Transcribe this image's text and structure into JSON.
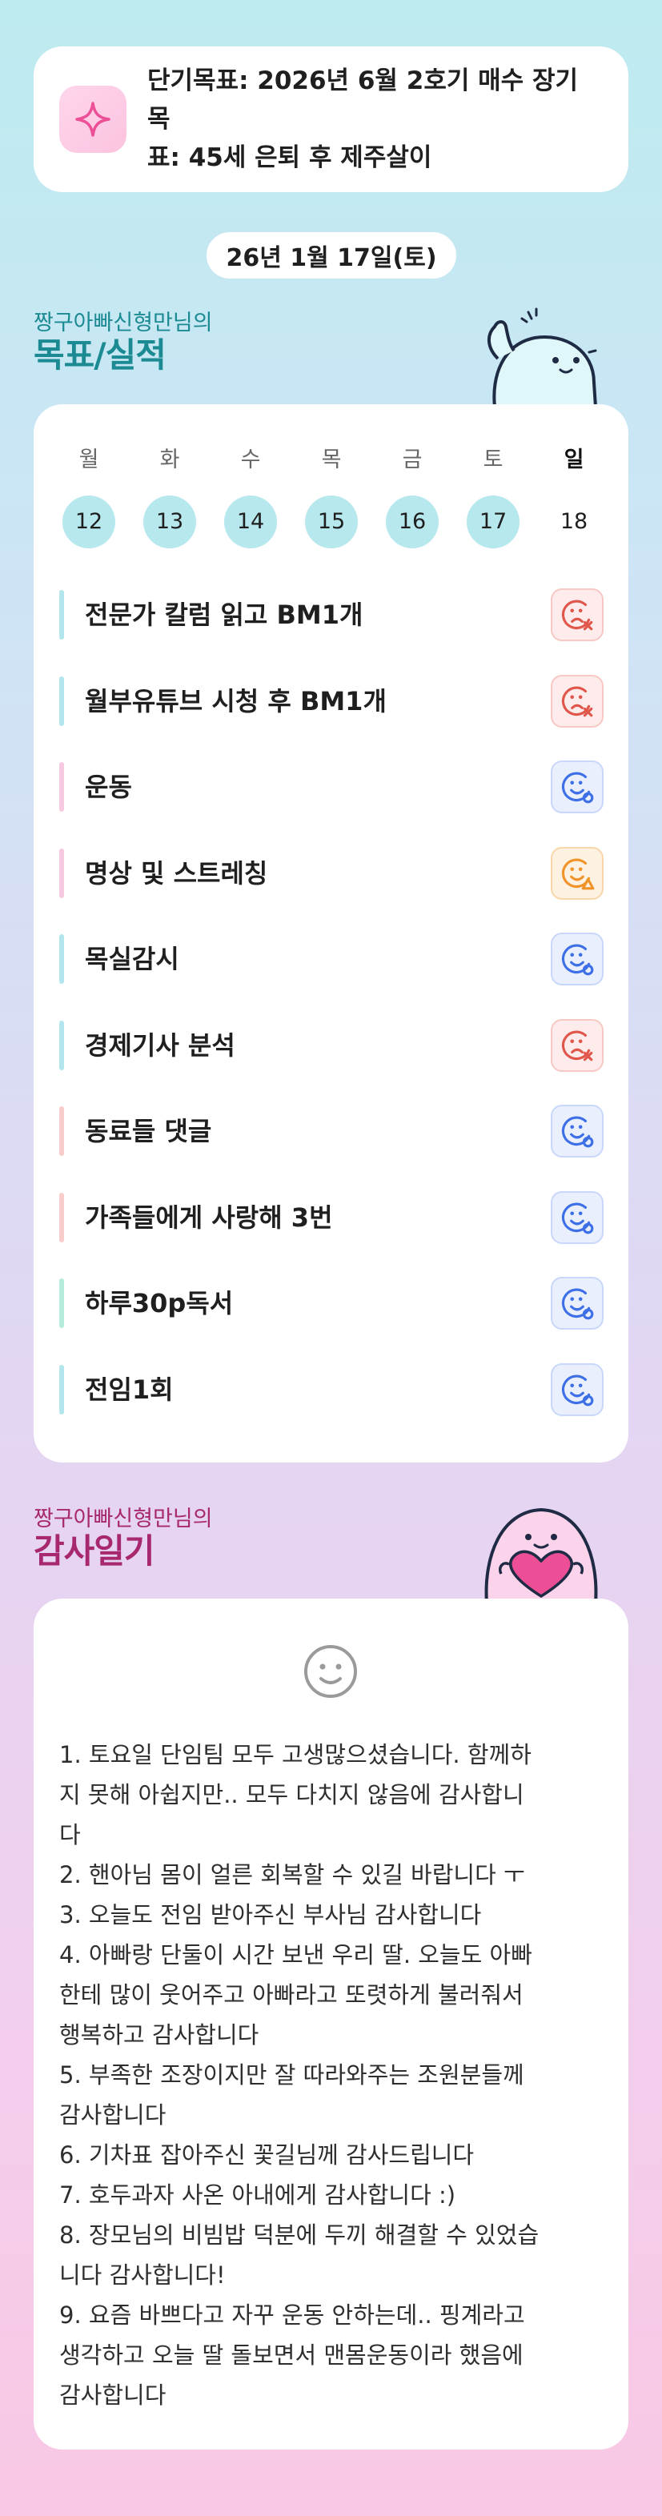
{
  "goal": {
    "text_line1": "단기목표: 2026년 6월 2호기 매수 장기목",
    "text_line2": "표: 45세 은퇴 후 제주살이",
    "icon": "sparkle-icon"
  },
  "date": "26년 1월 17일(토)",
  "record_section": {
    "subtitle": "짱구아빠신형만님의",
    "title": "목표/실적"
  },
  "week": {
    "days": [
      {
        "name": "월",
        "num": "12",
        "done": true
      },
      {
        "name": "화",
        "num": "13",
        "done": true
      },
      {
        "name": "수",
        "num": "14",
        "done": true
      },
      {
        "name": "목",
        "num": "15",
        "done": true
      },
      {
        "name": "금",
        "num": "16",
        "done": true
      },
      {
        "name": "토",
        "num": "17",
        "done": true
      },
      {
        "name": "일",
        "num": "18",
        "done": false
      }
    ]
  },
  "tasks": [
    {
      "label": "전문가 칼럼 읽고 BM1개",
      "status": "fail",
      "bar_color": "#b3e6ec"
    },
    {
      "label": "월부유튜브 시청 후 BM1개",
      "status": "fail",
      "bar_color": "#b3e6ec"
    },
    {
      "label": "운동",
      "status": "success",
      "bar_color": "#f6c9e1"
    },
    {
      "label": "명상 및 스트레칭",
      "status": "partial",
      "bar_color": "#f6c9e1"
    },
    {
      "label": "목실감시",
      "status": "success",
      "bar_color": "#b3e6ec"
    },
    {
      "label": "경제기사 분석",
      "status": "fail",
      "bar_color": "#b3e6ec"
    },
    {
      "label": "동료들 댓글",
      "status": "success",
      "bar_color": "#f8cccb"
    },
    {
      "label": "가족들에게 사랑해 3번",
      "status": "success",
      "bar_color": "#f8cccb"
    },
    {
      "label": "하루30p독서",
      "status": "success",
      "bar_color": "#b5ecdc"
    },
    {
      "label": "전임1회",
      "status": "success",
      "bar_color": "#b3e6ec"
    }
  ],
  "status_colors": {
    "fail": {
      "bg": "#fdeceb",
      "border": "#f7c8c4",
      "fg": "#e0564a"
    },
    "success": {
      "bg": "#e9effd",
      "border": "#c9d7fa",
      "fg": "#3d6fe6"
    },
    "partial": {
      "bg": "#fdf1e2",
      "border": "#f8d6aa",
      "fg": "#f0942a"
    }
  },
  "diary_section": {
    "subtitle": "짱구아빠신형만님의",
    "title": "감사일기"
  },
  "diary": {
    "icon": "smile-icon",
    "lines": [
      "1. 토요일 단임팀 모두 고생많으셨습니다. 함께하",
      "지 못해 아쉽지만.. 모두 다치지 않음에 감사합니",
      "다",
      "2. 핸아님 몸이 얼른 회복할 수 있길 바랍니다 ㅜ",
      "3. 오늘도 전임 받아주신 부사님 감사합니다",
      "4. 아빠랑 단둘이 시간 보낸 우리 딸. 오늘도 아빠",
      "한테 많이 웃어주고 아빠라고 또렷하게 불러줘서",
      "행복하고 감사합니다",
      "5. 부족한 조장이지만 잘 따라와주는 조원분들께",
      "감사합니다",
      "6. 기차표 잡아주신 꽃길님께 감사드립니다",
      "7. 호두과자 사온 아내에게 감사합니다 :)",
      "8. 장모님의 비빔밥 덕분에 두끼 해결할 수 있었습",
      "니다 감사합니다!",
      "9. 요즘 바쁘다고 자꾸 운동 안하는데.. 핑계라고",
      "생각하고 오늘 딸 돌보면서 맨몸운동이라 했음에",
      "감사합니다"
    ]
  }
}
